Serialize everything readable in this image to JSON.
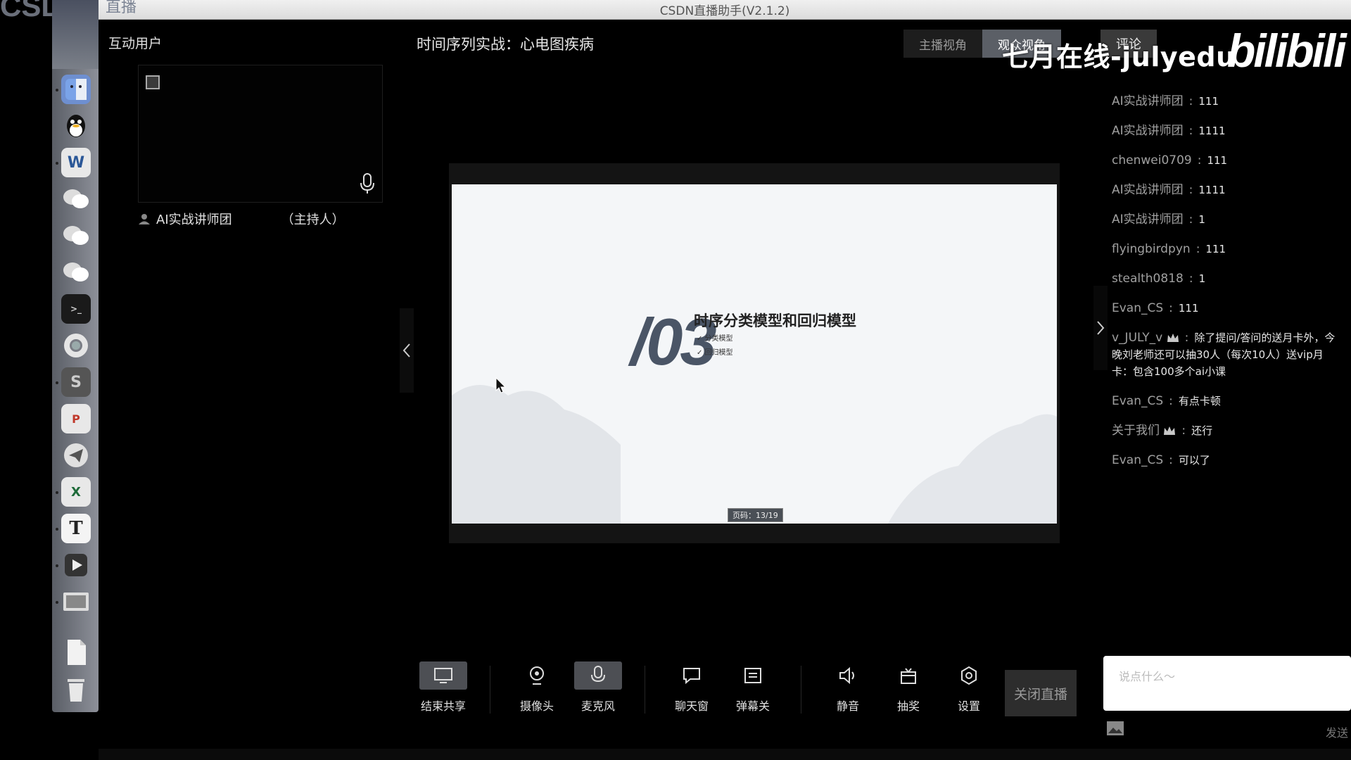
{
  "window": {
    "corner_text": "CSDI",
    "corner_fragment": "直播",
    "title": "CSDN直播助手(V2.1.2)"
  },
  "dock": {
    "icons": [
      "finder-icon",
      "qq-icon",
      "word-icon",
      "wechat-icon",
      "wechat-icon-2",
      "wechat-icon-3",
      "terminal-icon",
      "chrome-icon",
      "sublime-icon",
      "powerpoint-icon",
      "telegram-icon",
      "excel-icon",
      "typora-icon",
      "video-player-icon",
      "photos-icon",
      "document-icon",
      "trash-icon"
    ]
  },
  "left_panel": {
    "heading": "互动用户",
    "user_name": "AI实战讲师团",
    "user_role": "（主持人）"
  },
  "stream": {
    "title": "时间序列实战：心电图疾病",
    "tabs": [
      "主播视角",
      "观众视角"
    ],
    "active_tab": "观众视角",
    "comment_tab": "评论"
  },
  "watermark": {
    "text": "七月在线-julyedu",
    "logo": "bilibili"
  },
  "slide": {
    "number": "/03",
    "heading": "时序分类模型和回归模型",
    "bullets": [
      "✓ 分类模型",
      "✓ 回归模型"
    ],
    "page_indicator": "页码：13/19"
  },
  "chat": {
    "messages": [
      {
        "name": "AI实战讲师团",
        "text": "111",
        "crown": false
      },
      {
        "name": "AI实战讲师团",
        "text": "1111",
        "crown": false
      },
      {
        "name": "chenwei0709",
        "text": "111",
        "crown": false
      },
      {
        "name": "AI实战讲师团",
        "text": "1111",
        "crown": false
      },
      {
        "name": "AI实战讲师团",
        "text": "1",
        "crown": false
      },
      {
        "name": "flyingbirdpyn",
        "text": "111",
        "crown": false
      },
      {
        "name": "stealth0818",
        "text": "1",
        "crown": false
      },
      {
        "name": "Evan_CS",
        "text": "111",
        "crown": false
      },
      {
        "name": "v_JULY_v",
        "text": "除了提问/答问的送月卡外，今晚刘老师还可以抽30人（每次10人）送vip月卡：包含100多个ai小课",
        "crown": true
      },
      {
        "name": "Evan_CS",
        "text": "有点卡顿",
        "crown": false
      },
      {
        "name": "关于我们",
        "text": "还行",
        "crown": true
      },
      {
        "name": "Evan_CS",
        "text": "可以了",
        "crown": false
      }
    ],
    "input_placeholder": "说点什么～",
    "send_label": "发送"
  },
  "toolbar": {
    "end_share": "结束共享",
    "camera": "摄像头",
    "microphone": "麦克风",
    "chat_window": "聊天窗",
    "danmaku_off": "弹幕关",
    "mute": "静音",
    "lottery": "抽奖",
    "settings": "设置",
    "close_live": "关闭直播"
  }
}
